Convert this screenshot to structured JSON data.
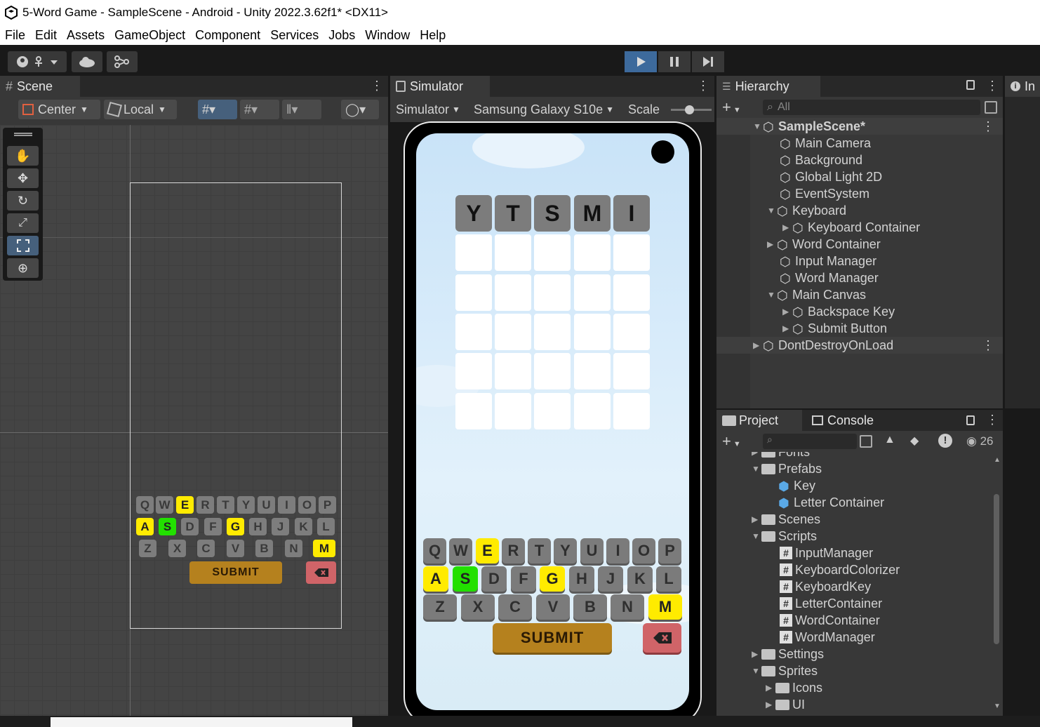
{
  "window": {
    "title": "5-Word Game - SampleScene - Android - Unity 2022.3.62f1* <DX11>"
  },
  "menu": [
    "File",
    "Edit",
    "Assets",
    "GameObject",
    "Component",
    "Services",
    "Jobs",
    "Window",
    "Help"
  ],
  "scene": {
    "tab": "Scene",
    "pivot": "Center",
    "space": "Local"
  },
  "simulator": {
    "tab": "Simulator",
    "mode": "Simulator",
    "device": "Samsung Galaxy S10e",
    "scale_label": "Scale",
    "guess": [
      "Y",
      "T",
      "S",
      "M",
      "I"
    ],
    "submit": "SUBMIT"
  },
  "hierarchy": {
    "tab": "Hierarchy",
    "search": "All",
    "scene": "SampleScene*",
    "items": [
      "Main Camera",
      "Background",
      "Global Light 2D",
      "EventSystem",
      "Keyboard",
      "Keyboard Container",
      "Word Container",
      "Input Manager",
      "Word Manager",
      "Main Canvas",
      "Backspace Key",
      "Submit Button"
    ],
    "ddol": "DontDestroyOnLoad"
  },
  "inspector": {
    "tab": "In"
  },
  "project": {
    "tab": "Project",
    "console_tab": "Console",
    "hidden_count": "26",
    "items": [
      "Fonts",
      "Prefabs",
      "Key",
      "Letter Container",
      "Scenes",
      "Scripts",
      "InputManager",
      "KeyboardColorizer",
      "KeyboardKey",
      "LetterContainer",
      "WordContainer",
      "WordManager",
      "Settings",
      "Sprites",
      "Icons",
      "UI"
    ]
  },
  "keyboard": {
    "rows": [
      [
        "Q",
        "W",
        "E",
        "R",
        "T",
        "Y",
        "U",
        "I",
        "O",
        "P"
      ],
      [
        "A",
        "S",
        "D",
        "F",
        "G",
        "H",
        "J",
        "K",
        "L"
      ],
      [
        "Z",
        "X",
        "C",
        "V",
        "B",
        "N",
        "M"
      ]
    ]
  }
}
